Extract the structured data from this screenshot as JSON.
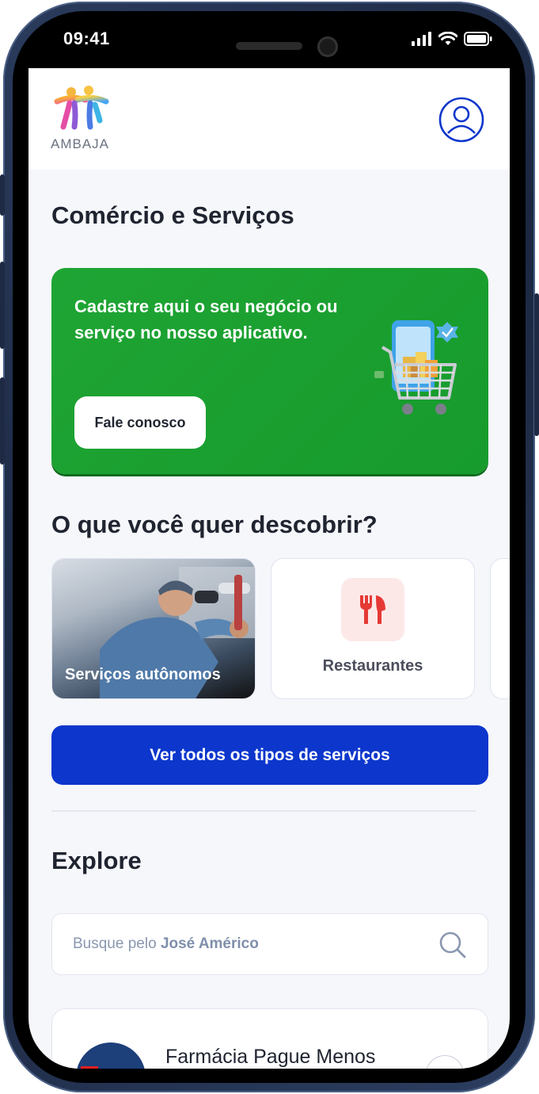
{
  "status_bar": {
    "time": "09:41"
  },
  "header": {
    "logo_text": "AMBAJA"
  },
  "commerce": {
    "title": "Comércio e Serviços",
    "banner_text": "Cadastre aqui o seu negócio ou serviço no nosso aplicativo.",
    "banner_button": "Fale conosco"
  },
  "discover": {
    "title": "O que você quer descobrir?",
    "categories": [
      {
        "label": "Serviços autônomos"
      },
      {
        "label": "Restaurantes"
      }
    ],
    "all_button": "Ver todos os tipos de serviços"
  },
  "explore": {
    "title": "Explore",
    "search": {
      "prefix": "Busque pelo",
      "place": "José Américo"
    },
    "results": [
      {
        "name": "Farmácia Pague Menos"
      }
    ]
  },
  "colors": {
    "banner_green": "#1fa534",
    "primary_blue": "#0c36cc",
    "restaurant_icon": "#e53935"
  }
}
